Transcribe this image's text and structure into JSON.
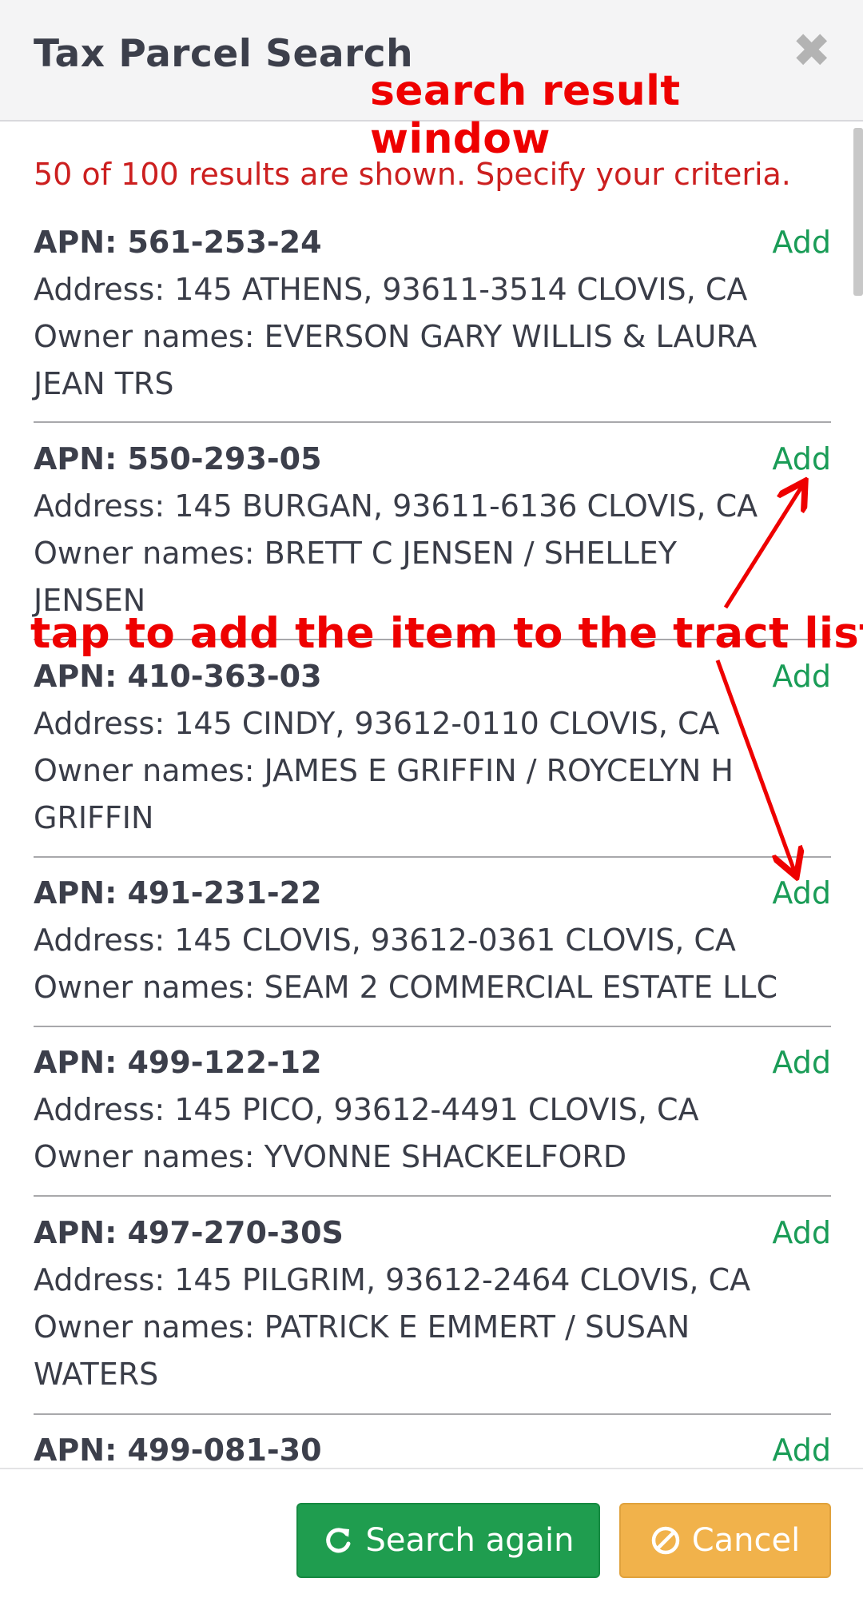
{
  "header": {
    "title": "Tax Parcel Search",
    "close_glyph": "✖"
  },
  "annotations": {
    "window_label": "search result window",
    "tap_label": "tap to add the item to the tract list",
    "color": "#ee0000"
  },
  "notice": "50 of 100 results are shown. Specify your criteria.",
  "results": [
    {
      "apn": "APN: 561-253-24",
      "add": "Add",
      "address": "Address: 145 ATHENS, 93611-3514 CLOVIS, CA",
      "owner_line1": "Owner names: EVERSON GARY WILLIS & LAURA",
      "owner_line2": "JEAN TRS"
    },
    {
      "apn": "APN: 550-293-05",
      "add": "Add",
      "address": "Address: 145 BURGAN, 93611-6136 CLOVIS, CA",
      "owner_line1": "Owner names: BRETT C JENSEN / SHELLEY",
      "owner_line2": "JENSEN"
    },
    {
      "apn": "APN: 410-363-03",
      "add": "Add",
      "address": "Address: 145 CINDY, 93612-0110 CLOVIS, CA",
      "owner_line1": "Owner names: JAMES E GRIFFIN / ROYCELYN H",
      "owner_line2": "GRIFFIN"
    },
    {
      "apn": "APN: 491-231-22",
      "add": "Add",
      "address": "Address: 145 CLOVIS, 93612-0361 CLOVIS, CA",
      "owner_line1": "Owner names: SEAM 2 COMMERCIAL ESTATE LLC"
    },
    {
      "apn": "APN: 499-122-12",
      "add": "Add",
      "address": "Address: 145 PICO, 93612-4491 CLOVIS, CA",
      "owner_line1": "Owner names: YVONNE SHACKELFORD"
    },
    {
      "apn": "APN: 497-270-30S",
      "add": "Add",
      "address": "Address: 145 PILGRIM, 93612-2464 CLOVIS, CA",
      "owner_line1": "Owner names: PATRICK E EMMERT / SUSAN",
      "owner_line2": "WATERS"
    },
    {
      "apn": "APN: 499-081-30",
      "add": "Add"
    }
  ],
  "footer": {
    "search_again": "Search again",
    "cancel": "Cancel"
  },
  "colors": {
    "add_link": "#1a9c57",
    "notice": "#cc1f1f",
    "search_button": "#1f9d4f",
    "cancel_button": "#f1b24b"
  },
  "icons": {
    "close": "close-icon",
    "search_again": "refresh-icon",
    "cancel": "ban-icon"
  }
}
